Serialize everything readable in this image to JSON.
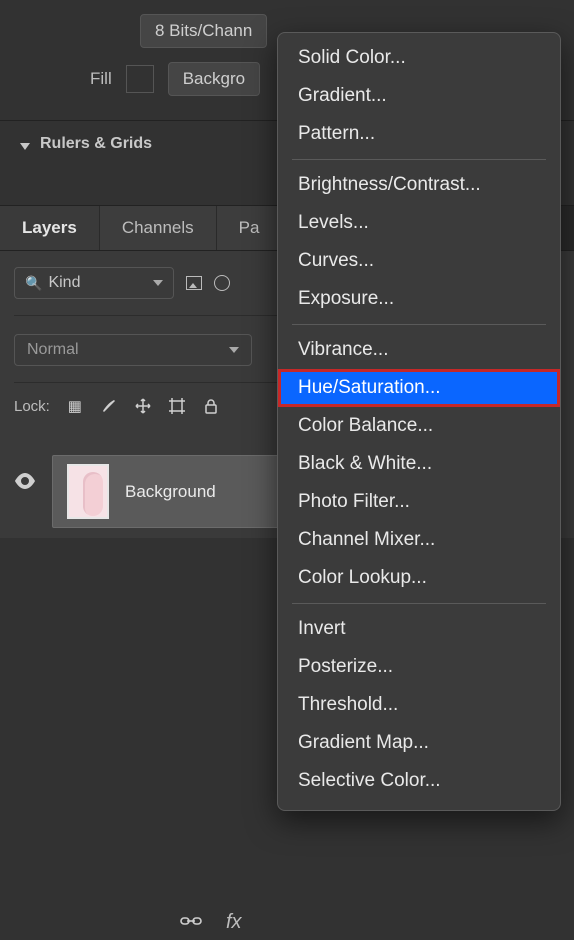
{
  "top": {
    "bits_label": "8 Bits/Chann",
    "fill_label": "Fill",
    "background_btn": "Backgro",
    "rulers_label": "Rulers & Grids"
  },
  "panels": {
    "tabs": [
      "Layers",
      "Channels",
      "Pa"
    ],
    "kind_label": "Kind",
    "blend_mode": "Normal",
    "lock_label": "Lock:",
    "layer": {
      "name": "Background"
    }
  },
  "bottom": {
    "link": "⌘",
    "fx": "fx"
  },
  "menu": {
    "group1": [
      "Solid Color...",
      "Gradient...",
      "Pattern..."
    ],
    "group2": [
      "Brightness/Contrast...",
      "Levels...",
      "Curves...",
      "Exposure..."
    ],
    "group3": [
      "Vibrance...",
      "Hue/Saturation...",
      "Color Balance...",
      "Black & White...",
      "Photo Filter...",
      "Channel Mixer...",
      "Color Lookup..."
    ],
    "group4": [
      "Invert",
      "Posterize...",
      "Threshold...",
      "Gradient Map...",
      "Selective Color..."
    ],
    "highlighted": "Hue/Saturation..."
  }
}
